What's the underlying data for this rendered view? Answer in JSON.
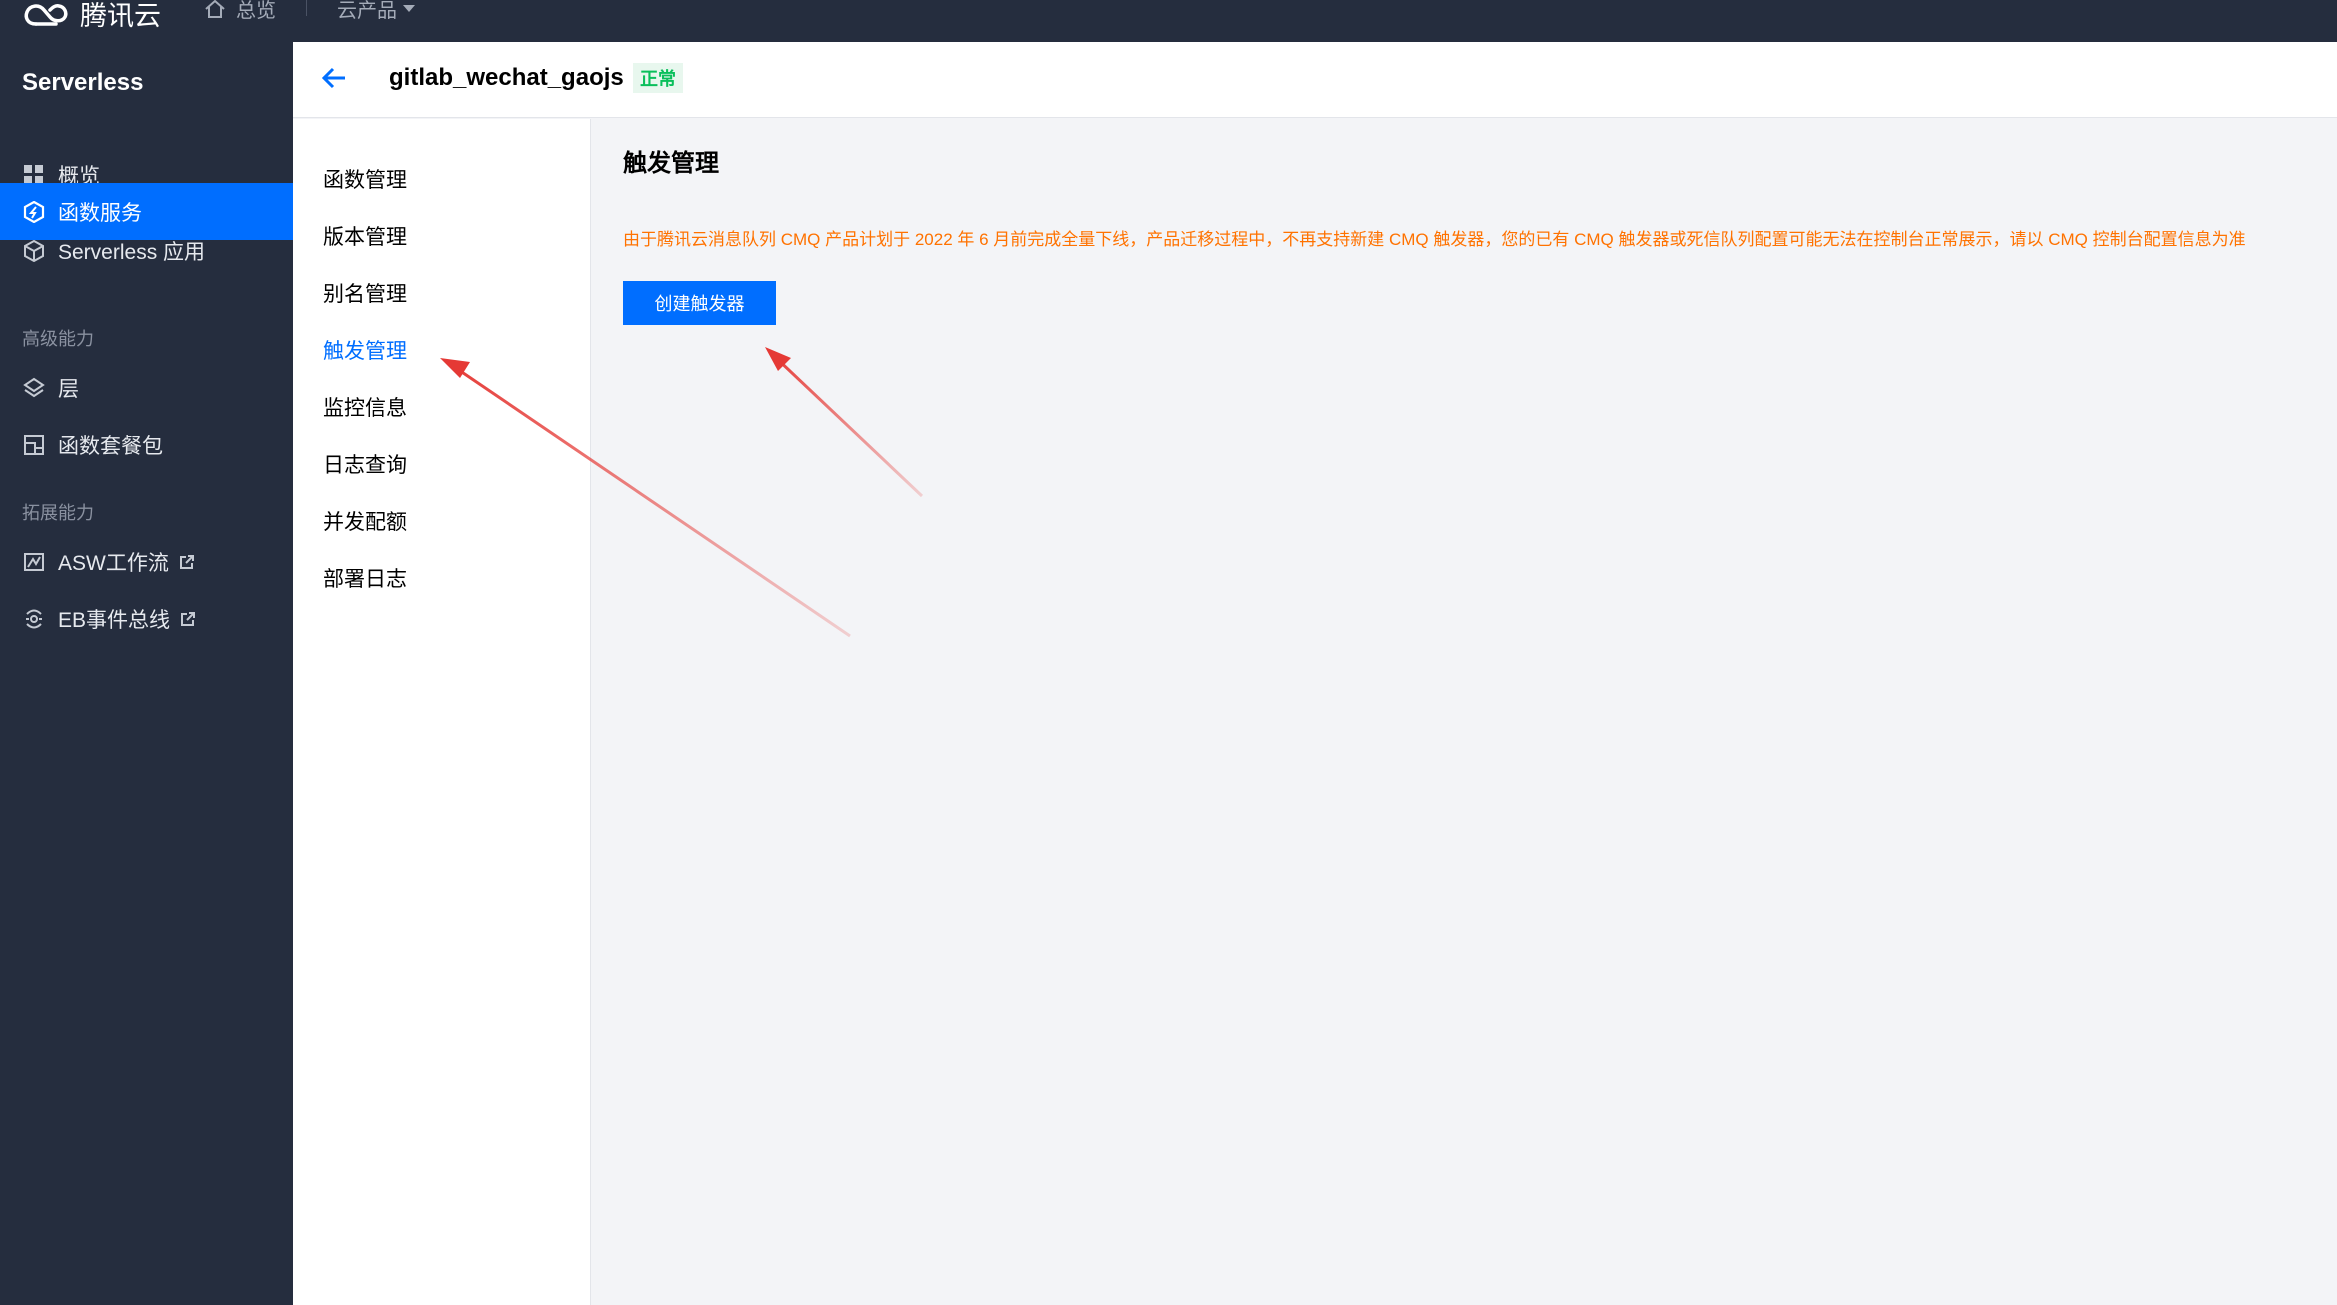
{
  "topbar": {
    "brand": "腾讯云",
    "home_label": "总览",
    "products_label": "云产品"
  },
  "sidebar": {
    "title": "Serverless",
    "items": [
      {
        "label": "概览",
        "icon": "grid-icon"
      },
      {
        "label": "函数服务",
        "icon": "function-icon",
        "active": true
      },
      {
        "label": "Serverless 应用",
        "icon": "cube-icon"
      }
    ],
    "group_advanced": "高级能力",
    "advanced_items": [
      {
        "label": "层",
        "icon": "layers-icon"
      },
      {
        "label": "函数套餐包",
        "icon": "package-icon"
      }
    ],
    "group_extend": "拓展能力",
    "extend_items": [
      {
        "label": "ASW工作流",
        "icon": "workflow-icon",
        "external": true
      },
      {
        "label": "EB事件总线",
        "icon": "eventbus-icon",
        "external": true
      }
    ]
  },
  "header": {
    "function_name": "gitlab_wechat_gaojs",
    "status": "正常"
  },
  "subnav": {
    "items": [
      {
        "label": "函数管理"
      },
      {
        "label": "版本管理"
      },
      {
        "label": "别名管理"
      },
      {
        "label": "触发管理",
        "active": true
      },
      {
        "label": "监控信息"
      },
      {
        "label": "日志查询"
      },
      {
        "label": "并发配额"
      },
      {
        "label": "部署日志"
      }
    ]
  },
  "content": {
    "title": "触发管理",
    "notice": "由于腾讯云消息队列 CMQ 产品计划于 2022 年 6 月前完成全量下线，产品迁移过程中，不再支持新建 CMQ 触发器，您的已有 CMQ 触发器或死信队列配置可能无法在控制台正常展示，请以 CMQ 控制台配置信息为准",
    "create_button": "创建触发器"
  },
  "colors": {
    "nav_bg": "#252d3e",
    "accent": "#006eff",
    "notice": "#ff7200",
    "status_green": "#0abf5b",
    "annotation_red": "#e53935"
  }
}
